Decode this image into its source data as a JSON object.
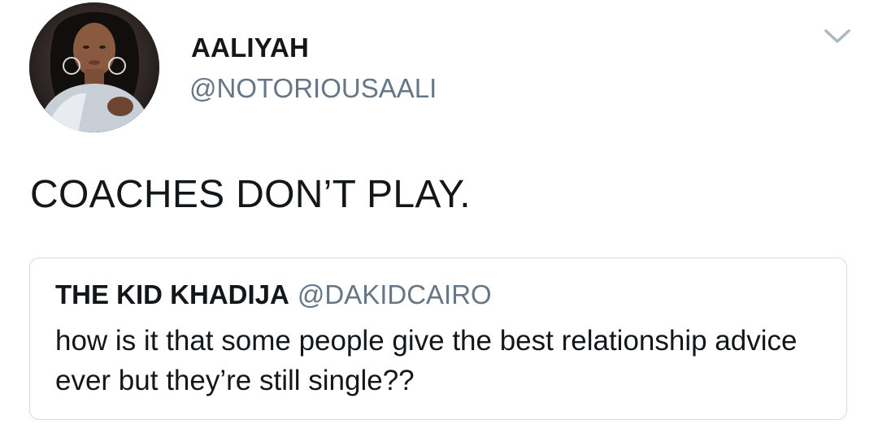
{
  "tweet": {
    "author": {
      "display_name": "AALIYAH",
      "handle": "@NOTORIOUSAALI",
      "avatar_icon": "user-avatar-photo"
    },
    "menu_icon": "chevron-down-icon",
    "text": "COACHES DON’T PLAY.",
    "quoted_tweet": {
      "display_name": "THE KID KHADIJA",
      "handle": "@DAKIDCAIRO",
      "text": "how is it that some people give the best relationship advice ever but they’re still single??"
    }
  },
  "colors": {
    "text_primary": "#14171a",
    "text_secondary": "#657786",
    "border": "#d4dde3",
    "caret": "#aab8c2"
  }
}
